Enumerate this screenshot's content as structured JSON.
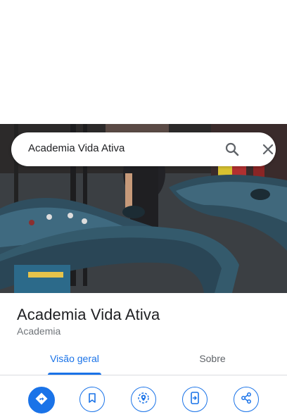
{
  "search": {
    "query": "Academia Vida Ativa"
  },
  "place": {
    "name": "Academia Vida Ativa",
    "category": "Academia"
  },
  "tabs": [
    {
      "label": "Visão geral",
      "selected": true
    },
    {
      "label": "Sobre",
      "selected": false
    }
  ],
  "actions": [
    {
      "icon": "directions-icon"
    },
    {
      "icon": "save-icon"
    },
    {
      "icon": "nearby-icon"
    },
    {
      "icon": "send-to-phone-icon"
    },
    {
      "icon": "share-icon"
    }
  ],
  "colors": {
    "accent": "#1a73e8",
    "text": "#202124",
    "secondary": "#70757a"
  }
}
